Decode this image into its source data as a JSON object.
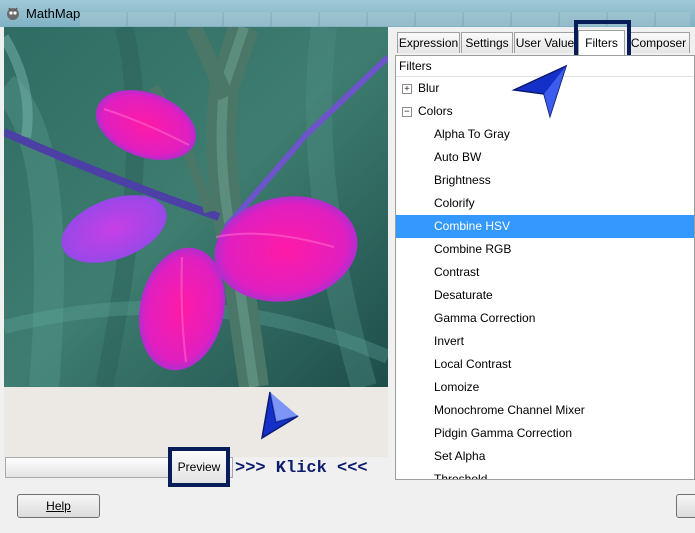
{
  "window": {
    "title": "MathMap",
    "icon": "gimp-icon"
  },
  "tabs": [
    {
      "label": "Expression",
      "active": false
    },
    {
      "label": "Settings",
      "active": false
    },
    {
      "label": "User Value",
      "active": false
    },
    {
      "label": "Filters",
      "active": true
    },
    {
      "label": "Composer",
      "active": false
    }
  ],
  "filters": {
    "header": "Filters",
    "groups": [
      {
        "label": "Blur",
        "expanded": false,
        "expander": "+"
      },
      {
        "label": "Colors",
        "expanded": true,
        "expander": "−"
      }
    ],
    "items": [
      {
        "label": "Alpha To Gray",
        "selected": false
      },
      {
        "label": "Auto BW",
        "selected": false
      },
      {
        "label": "Brightness",
        "selected": false
      },
      {
        "label": "Colorify",
        "selected": false
      },
      {
        "label": "Combine HSV",
        "selected": true
      },
      {
        "label": "Combine RGB",
        "selected": false
      },
      {
        "label": "Contrast",
        "selected": false
      },
      {
        "label": "Desaturate",
        "selected": false
      },
      {
        "label": "Gamma Correction",
        "selected": false
      },
      {
        "label": "Invert",
        "selected": false
      },
      {
        "label": "Local Contrast",
        "selected": false
      },
      {
        "label": "Lomoize",
        "selected": false
      },
      {
        "label": "Monochrome Channel Mixer",
        "selected": false
      },
      {
        "label": "Pidgin Gamma Correction",
        "selected": false
      },
      {
        "label": "Set Alpha",
        "selected": false
      },
      {
        "label": "Threshold",
        "selected": false
      }
    ]
  },
  "preview": {
    "button_label": "Preview",
    "annotation": ">>> Klick <<<"
  },
  "buttons": {
    "help": "Help"
  },
  "colors": {
    "selection": "#3399ff",
    "highlight_box": "#061d5a",
    "annotation_text": "#0d1d6b",
    "arrow": "#1530c8"
  }
}
